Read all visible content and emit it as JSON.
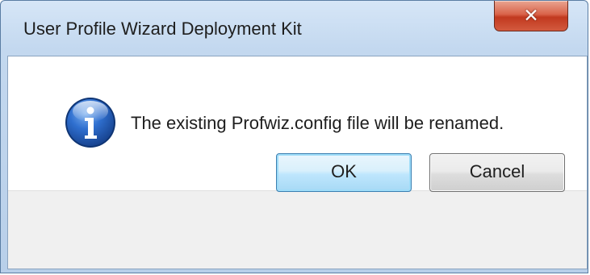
{
  "window": {
    "title": "User Profile Wizard Deployment Kit",
    "close_icon": "close-icon"
  },
  "dialog": {
    "icon": "info-icon",
    "message": "The existing Profwiz.config file will be renamed."
  },
  "buttons": {
    "ok_label": "OK",
    "cancel_label": "Cancel"
  },
  "colors": {
    "titlebar": "#c3d8ef",
    "close_button": "#c1391f",
    "info_icon": "#1f5fb8",
    "button_bar": "#f0f0f0",
    "ok_focus": "#3c7fb1"
  }
}
